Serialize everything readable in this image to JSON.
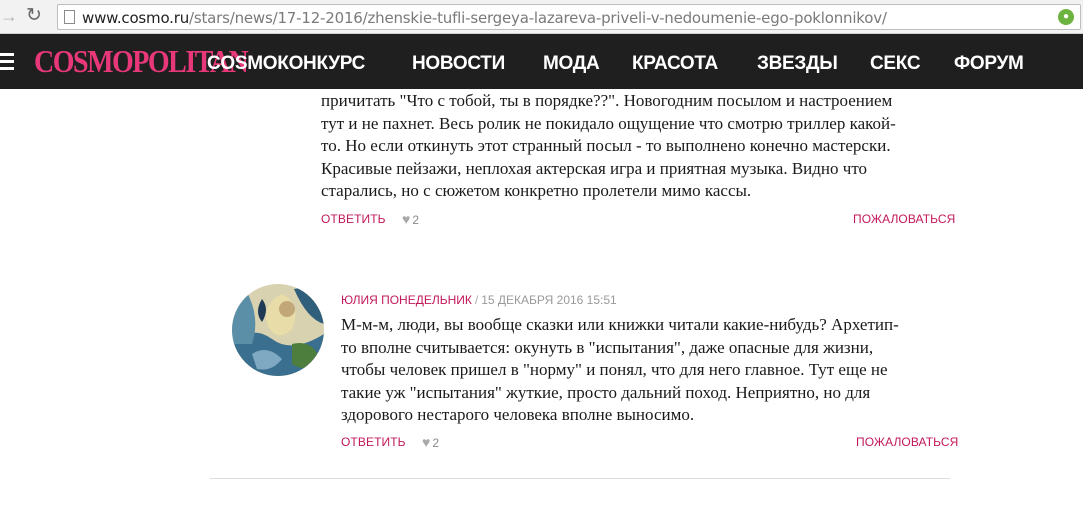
{
  "browser": {
    "url_host": "www.cosmo.ru",
    "url_path": "/stars/news/17-12-2016/zhenskie-tufli-sergeya-lazareva-priveli-v-nedoumenie-ego-poklonnikov/",
    "icons": {
      "forward": "arrow-right-icon",
      "reload": "reload-icon",
      "page": "page-icon",
      "extension": "lock-icon"
    }
  },
  "header": {
    "logo": "COSMOPOLITAN",
    "nav": [
      "COSMOКОНКУРС",
      "НОВОСТИ",
      "МОДА",
      "КРАСОТА",
      "ЗВЕЗДЫ",
      "СЕКС",
      "ФОРУМ"
    ]
  },
  "comments": [
    {
      "text": "причитать \"Что с тобой, ты в порядке??\".  Новогодним посылом и настроением\nтут и не пахнет. Весь ролик не покидало ощущение что смотрю триллер какой-\nто. Но если откинуть этот странный посыл - то выполнено конечно мастерски.\nКрасивые пейзажи, неплохая актерская игра и приятная музыка. Видно что\nстарались, но с сюжетом конкретно пролетели мимо кассы.",
      "reply": "Ответить",
      "likes": "2",
      "report": "Пожаловаться"
    },
    {
      "author": "Юлия Понедельник",
      "separator": "/",
      "date": "15 декабря 2016 15:51",
      "text": "М-м-м, люди, вы вообще сказки или книжки читали какие-нибудь? Архетип-\nто вполне считывается: окунуть в \"испытания\", даже опасные для жизни,\nчтобы человек пришел в \"норму\" и понял, что для него главное. Тут еще не\nтакие уж \"испытания\" жуткие, просто дальний поход. Неприятно, но для\nздорового нестарого человека вполне выносимо.",
      "reply": "Ответить",
      "likes": "2",
      "report": "Пожаловаться"
    }
  ],
  "colors": {
    "accent": "#c2185b",
    "logo": "#e8387a",
    "header_bg": "#1f1f1f"
  }
}
